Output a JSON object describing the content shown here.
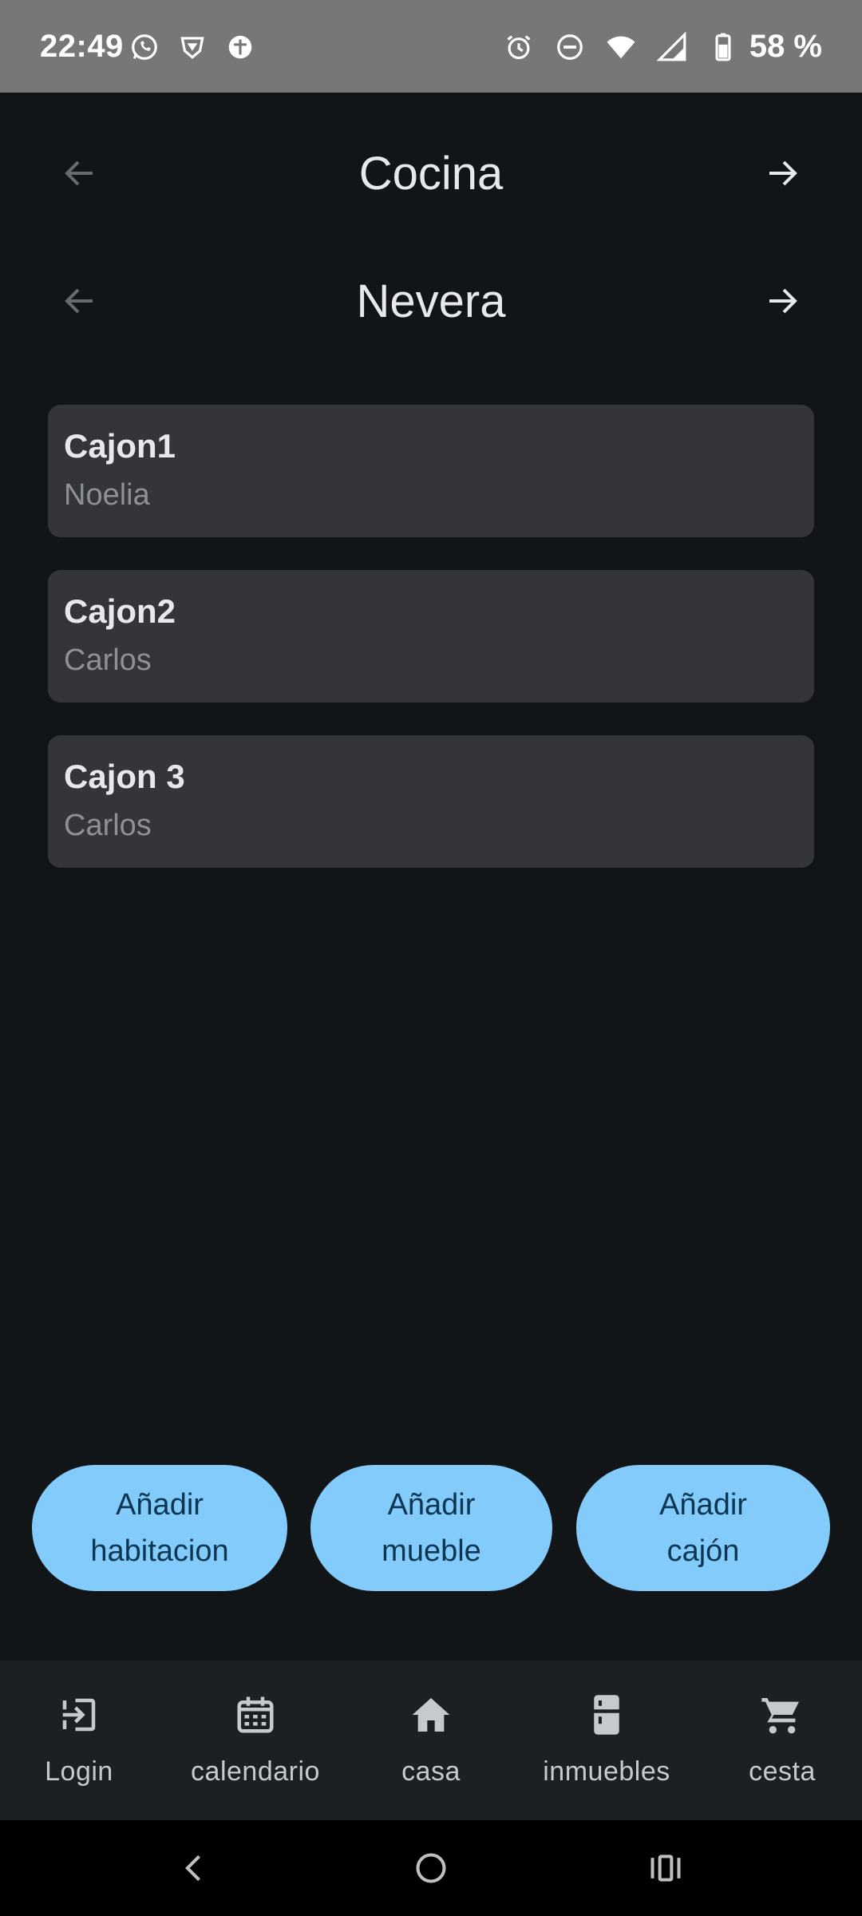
{
  "status_bar": {
    "time": "22:49",
    "battery": "58 %",
    "left_icons": [
      "whatsapp-icon",
      "brave-icon",
      "app-icon"
    ],
    "right_icons": [
      "alarm-icon",
      "do-not-disturb-icon",
      "wifi-icon",
      "signal-icon",
      "battery-icon"
    ]
  },
  "room_selector": {
    "title": "Cocina"
  },
  "furniture_selector": {
    "title": "Nevera"
  },
  "drawers": [
    {
      "name": "Cajon1",
      "owner": "Noelia"
    },
    {
      "name": "Cajon2",
      "owner": "Carlos"
    },
    {
      "name": "Cajon 3",
      "owner": "Carlos"
    }
  ],
  "actions": {
    "add_room": {
      "line1": "Añadir",
      "line2": "habitacion"
    },
    "add_furniture": {
      "line1": "Añadir",
      "line2": "mueble"
    },
    "add_drawer": {
      "line1": "Añadir",
      "line2": "cajón"
    }
  },
  "bottom_nav": [
    {
      "label": "Login",
      "icon": "login-icon"
    },
    {
      "label": "calendario",
      "icon": "calendar-icon"
    },
    {
      "label": "casa",
      "icon": "home-icon"
    },
    {
      "label": "inmuebles",
      "icon": "fridge-icon"
    },
    {
      "label": "cesta",
      "icon": "cart-icon"
    }
  ],
  "colors": {
    "background": "#111518",
    "card": "#333538",
    "accent_button": "#82cbfa",
    "nav_bar": "#1c1f23"
  }
}
